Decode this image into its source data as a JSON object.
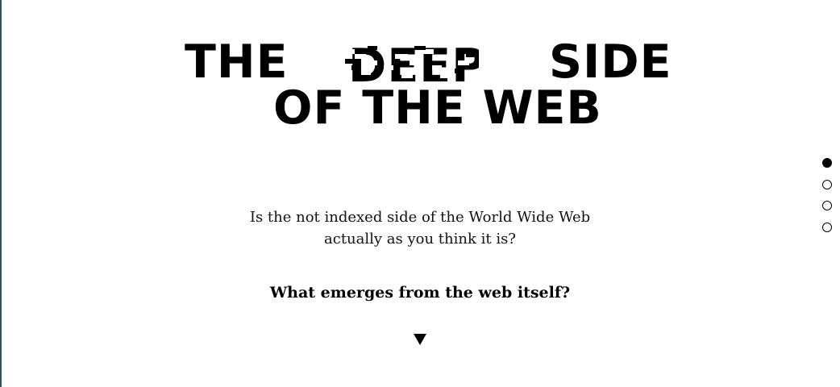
{
  "title": {
    "word1": "THE",
    "word2": "DEEP",
    "word3": "SIDE",
    "line2": "OF THE WEB"
  },
  "subtitle": {
    "line1": "Is the not indexed side of the World Wide Web",
    "line2": "actually as you think it is?"
  },
  "question": "What emerges from the web itself?",
  "scroll_icon": "triangle-down-icon",
  "nav_dots": [
    {
      "active": true
    },
    {
      "active": false
    },
    {
      "active": false
    },
    {
      "active": false
    }
  ]
}
